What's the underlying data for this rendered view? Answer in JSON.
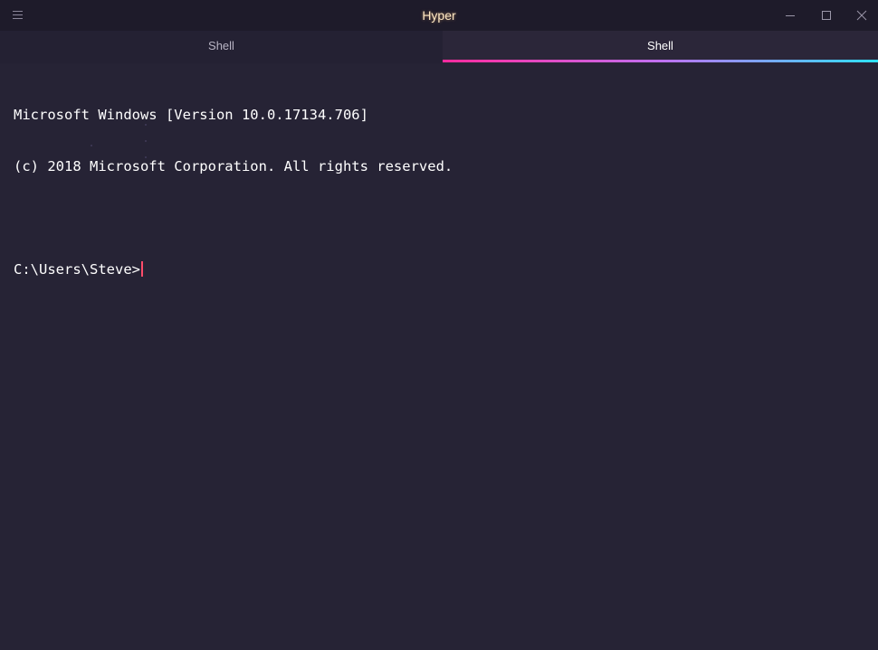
{
  "window": {
    "title": "Hyper",
    "controls": {
      "menu_icon": "hamburger-menu-icon",
      "minimize_icon": "minimize-icon",
      "maximize_icon": "maximize-icon",
      "close_icon": "close-icon"
    }
  },
  "tabs": [
    {
      "label": "Shell",
      "active": false
    },
    {
      "label": "Shell",
      "active": true
    }
  ],
  "terminal": {
    "lines": [
      "Microsoft Windows [Version 10.0.17134.706]",
      "(c) 2018 Microsoft Corporation. All rights reserved.",
      ""
    ],
    "prompt": "C:\\Users\\Steve>"
  },
  "colors": {
    "background": "#262335",
    "titlebar": "#1e1b2a",
    "title_text": "#ffe9c4",
    "tab_active_underline_start": "#ff2a9d",
    "tab_active_underline_mid": "#c070f0",
    "tab_active_underline_end": "#2de2ff",
    "cursor": "#ff4c6a",
    "text": "#ffffff"
  }
}
